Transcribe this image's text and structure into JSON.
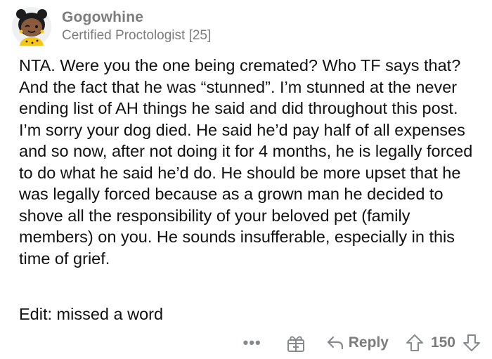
{
  "comment": {
    "username": "Gogowhine",
    "flair": "Certified Proctologist [25]",
    "body": "NTA. Were you the one being cremated? Who TF says that? And the fact that he was “stunned”. I’m stunned at the never ending list of AH things he said and did throughout this post. I’m sorry your dog died. He said he’d pay half of all expenses and so now, after not doing it for 4 months, he is legally forced to do what he said he’d do. He should be more upset that he was legally forced because as a grown man he decided to shove all the responsibility of your beloved pet (family members) on you. He sounds insufferable, especially in this time of grief.",
    "edit": "Edit: missed a word"
  },
  "actions": {
    "more_label": "•••",
    "reply_label": "Reply",
    "score": "150"
  },
  "icons": {
    "avatar": "snoo-avatar-icon",
    "award": "gift-icon",
    "reply": "reply-arrow-icon",
    "upvote": "upvote-arrow-icon",
    "downvote": "downvote-arrow-icon"
  },
  "colors": {
    "meta_gray": "#7c7c7c",
    "text": "#111111",
    "avatar_skin": "#8a5a3c",
    "avatar_hair": "#1c1c1c",
    "avatar_shirt": "#f5c518"
  }
}
